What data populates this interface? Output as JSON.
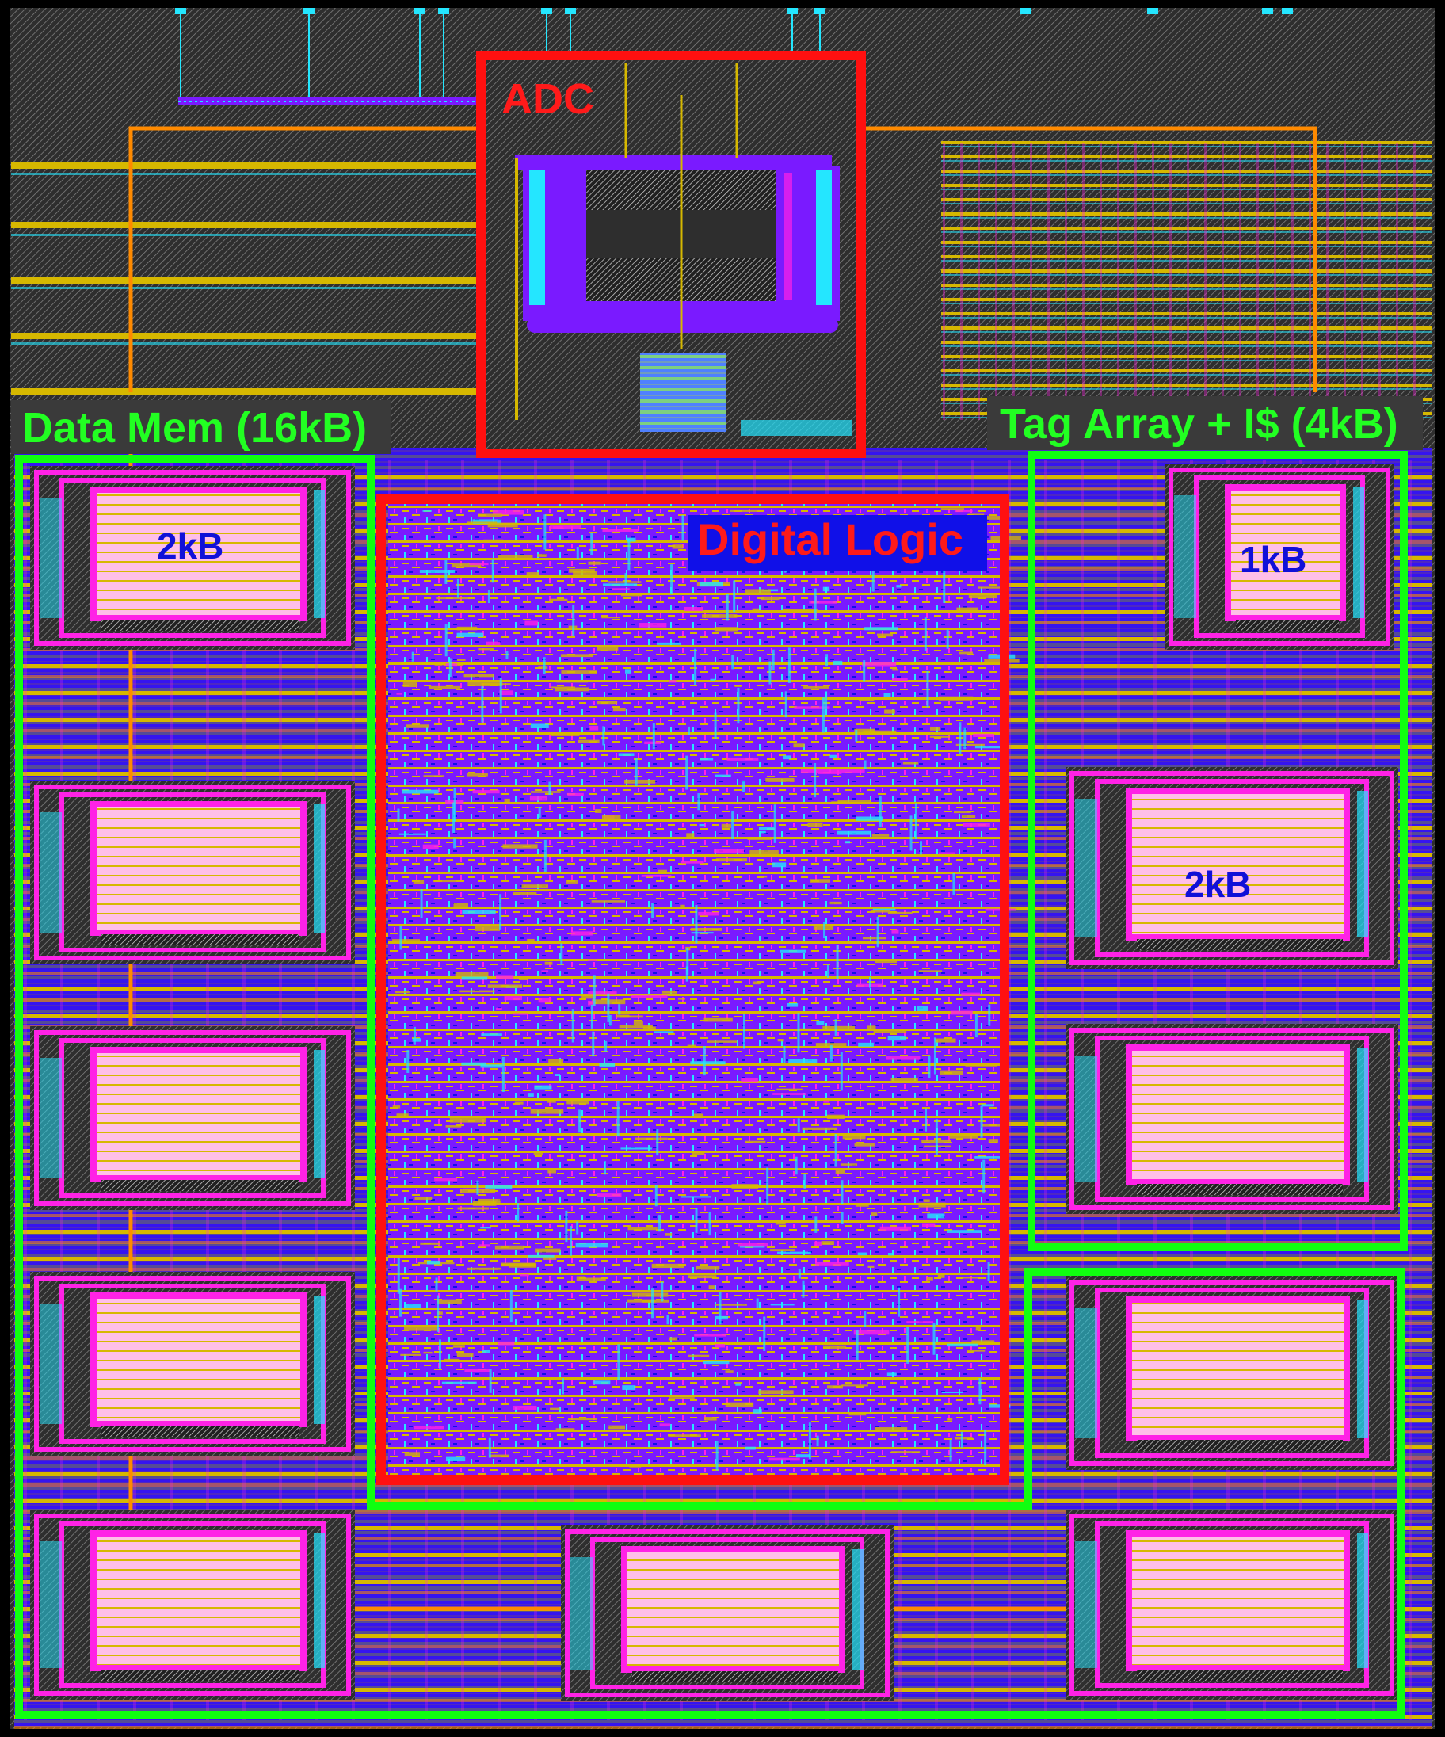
{
  "labels": {
    "adc": "ADC",
    "digital_logic": "Digital Logic",
    "data_mem": "Data Mem (16kB)",
    "tag_array": "Tag Array + I$ (4kB)",
    "mem_2kb_left": "2kB",
    "mem_1kb_right": "1kB",
    "mem_2kb_right": "2kB"
  },
  "colors": {
    "background": "#2a2a2a",
    "core_fill": "#1010e8",
    "cell_purple": "#7a1aff",
    "metal_yellow": "#d6b800",
    "metal_orange": "#ff8a00",
    "cyan": "#24e6ff",
    "magenta": "#ff22e6",
    "sram_pink": "#ffbfe8",
    "adc_box": "#ff1010",
    "logic_box": "#ff1010",
    "mem_group_box": "#10ff10",
    "label_green": "#22ff22",
    "label_red": "#ff1a1a",
    "label_blue": "#1010d8",
    "label_plate": "#3a3a3a"
  }
}
